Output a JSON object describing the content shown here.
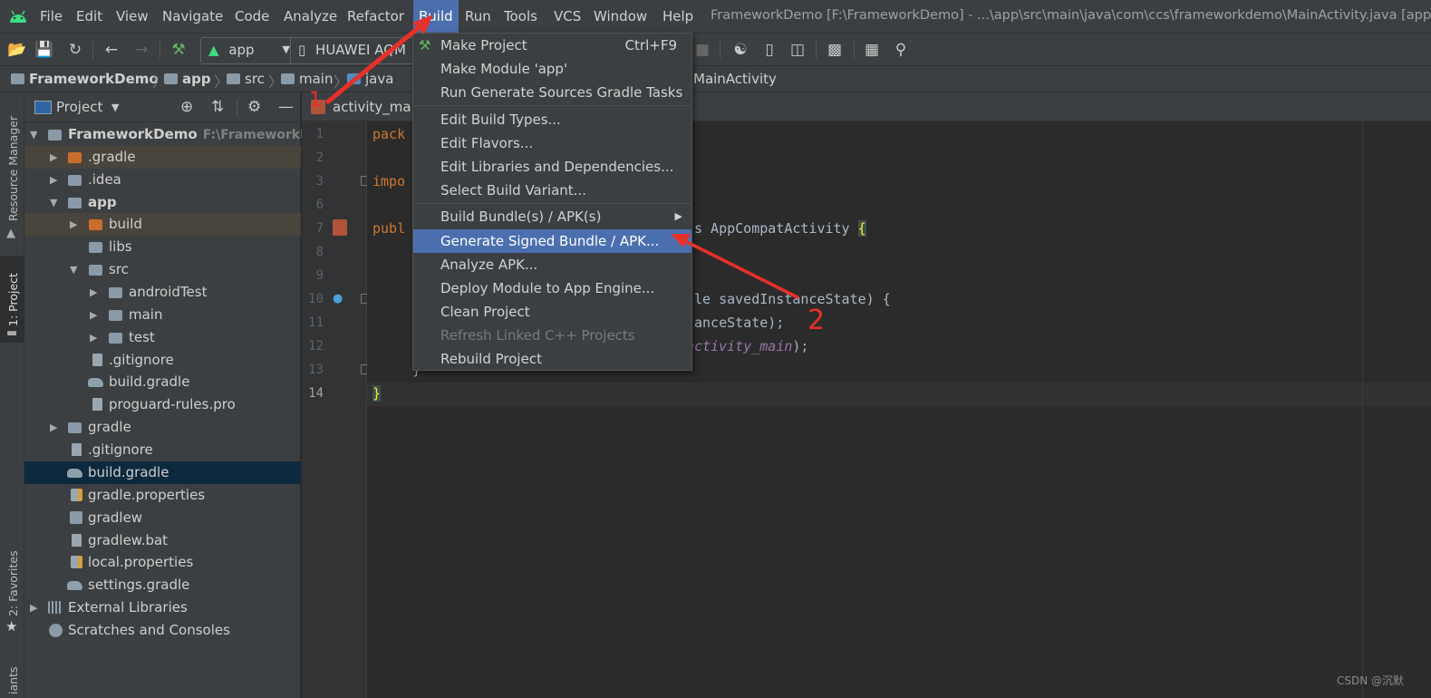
{
  "menubar": {
    "items": [
      "File",
      "Edit",
      "View",
      "Navigate",
      "Code",
      "Analyze",
      "Refactor",
      "Build",
      "Run",
      "Tools",
      "VCS",
      "Window",
      "Help"
    ],
    "active": "Build",
    "window_title": "FrameworkDemo [F:\\FrameworkDemo] - ...\\app\\src\\main\\java\\com\\ccs\\frameworkdemo\\MainActivity.java [app]"
  },
  "toolbar": {
    "run_config": "app",
    "device": "HUAWEI AQM"
  },
  "breadcrumb": {
    "items": [
      "FrameworkDemo",
      "app",
      "src",
      "main",
      "java",
      "MainActivity"
    ]
  },
  "left_stripe": {
    "resource_manager": "Resource Manager",
    "project": "1: Project",
    "favorites": "2: Favorites",
    "variants": "iants"
  },
  "project_panel": {
    "title": "Project",
    "tree": [
      {
        "label": "FrameworkDemo",
        "path": "F:\\FrameworkDe"
      },
      {
        "label": ".gradle"
      },
      {
        "label": ".idea"
      },
      {
        "label": "app"
      },
      {
        "label": "build"
      },
      {
        "label": "libs"
      },
      {
        "label": "src"
      },
      {
        "label": "androidTest"
      },
      {
        "label": "main"
      },
      {
        "label": "test"
      },
      {
        "label": ".gitignore"
      },
      {
        "label": "build.gradle"
      },
      {
        "label": "proguard-rules.pro"
      },
      {
        "label": "gradle"
      },
      {
        "label": ".gitignore"
      },
      {
        "label": "build.gradle"
      },
      {
        "label": "gradle.properties"
      },
      {
        "label": "gradlew"
      },
      {
        "label": "gradlew.bat"
      },
      {
        "label": "local.properties"
      },
      {
        "label": "settings.gradle"
      },
      {
        "label": "External Libraries"
      },
      {
        "label": "Scratches and Consoles"
      }
    ]
  },
  "editor": {
    "tab": "activity_main",
    "line_numbers": [
      "1",
      "2",
      "3",
      "6",
      "7",
      "8",
      "9",
      "10",
      "11",
      "12",
      "13",
      "14"
    ],
    "code": {
      "l1": "pack",
      "l3": "impo",
      "l7a": "publ",
      "l7b": "s AppCompatActivity ",
      "l7brace": "{",
      "l10": "le savedInstanceState) {",
      "l11": "anceState);",
      "l12a": "activity_main",
      "l12b": ");",
      "l13": "}",
      "l14": "}"
    }
  },
  "build_menu": {
    "items": [
      {
        "label": "Make Project",
        "shortcut": "Ctrl+F9"
      },
      {
        "label": "Make Module 'app'"
      },
      {
        "label": "Run Generate Sources Gradle Tasks"
      },
      {
        "label": "Edit Build Types..."
      },
      {
        "label": "Edit Flavors..."
      },
      {
        "label": "Edit Libraries and Dependencies..."
      },
      {
        "label": "Select Build Variant..."
      },
      {
        "label": "Build Bundle(s) / APK(s)"
      },
      {
        "label": "Generate Signed Bundle / APK..."
      },
      {
        "label": "Analyze APK..."
      },
      {
        "label": "Deploy Module to App Engine..."
      },
      {
        "label": "Clean Project"
      },
      {
        "label": "Refresh Linked C++ Projects"
      },
      {
        "label": "Rebuild Project"
      }
    ]
  },
  "annotations": {
    "step1": "1",
    "step2": "2"
  },
  "watermark": "CSDN @沉默",
  "colors": {
    "accent": "#4b6eaf",
    "annotation": "#e8302a",
    "keyword": "#cc7832"
  }
}
